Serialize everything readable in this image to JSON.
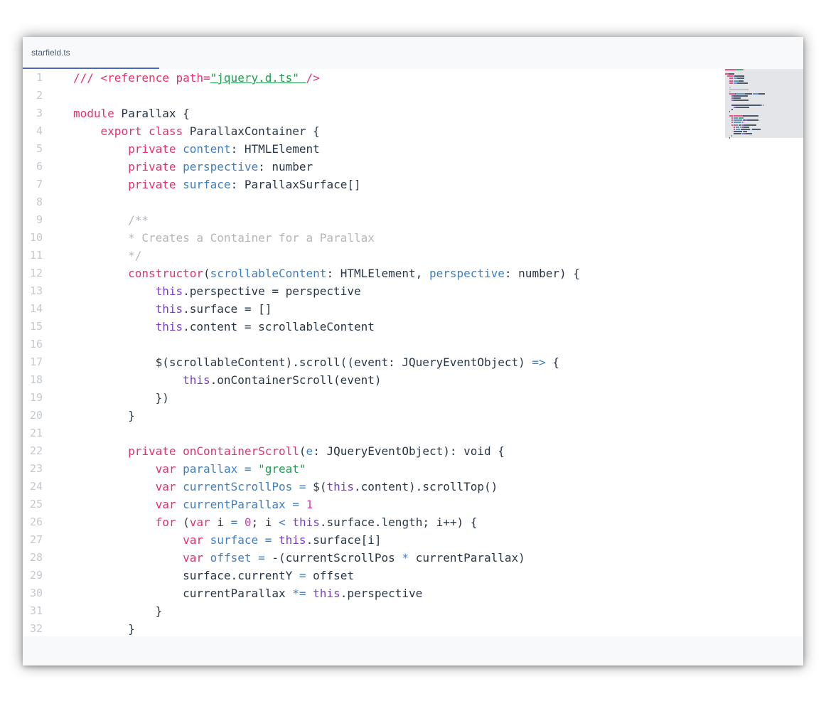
{
  "tab": {
    "label": "starfield.ts"
  },
  "colors": {
    "keyword": "#e2336b",
    "this": "#7a3ec4",
    "identifier": "#3f7fc0",
    "string": "#1e9e4e",
    "number": "#d63fb3",
    "comment": "#b3b7bc",
    "plain": "#283747",
    "tab_underline": "#4a6da7"
  },
  "line_numbers": [
    "1",
    "2",
    "3",
    "4",
    "5",
    "6",
    "7",
    "8",
    "9",
    "10",
    "11",
    "12",
    "13",
    "14",
    "15",
    "16",
    "17",
    "18",
    "19",
    "20",
    "21",
    "22",
    "23",
    "24",
    "25",
    "26",
    "27",
    "28",
    "29",
    "30",
    "31",
    "32"
  ],
  "lines": [
    [
      [
        "kw",
        "/// <reference path="
      ],
      [
        "strlink",
        "\"jquery.d.ts\" "
      ],
      [
        "kw",
        "/>"
      ]
    ],
    [],
    [
      [
        "kw",
        "module"
      ],
      [
        "plain",
        " Parallax {"
      ]
    ],
    [
      [
        "plain",
        "    "
      ],
      [
        "kw",
        "export"
      ],
      [
        "plain",
        " "
      ],
      [
        "kw",
        "class"
      ],
      [
        "plain",
        " ParallaxContainer {"
      ]
    ],
    [
      [
        "plain",
        "        "
      ],
      [
        "kw",
        "private"
      ],
      [
        "plain",
        " "
      ],
      [
        "id",
        "content"
      ],
      [
        "plain",
        ": HTMLElement"
      ]
    ],
    [
      [
        "plain",
        "        "
      ],
      [
        "kw",
        "private"
      ],
      [
        "plain",
        " "
      ],
      [
        "id",
        "perspective"
      ],
      [
        "plain",
        ": number"
      ]
    ],
    [
      [
        "plain",
        "        "
      ],
      [
        "kw",
        "private"
      ],
      [
        "plain",
        " "
      ],
      [
        "id",
        "surface"
      ],
      [
        "plain",
        ": ParallaxSurface[]"
      ]
    ],
    [],
    [
      [
        "cm",
        "        /**"
      ]
    ],
    [
      [
        "cm",
        "        * Creates a Container for a Parallax"
      ]
    ],
    [
      [
        "cm",
        "        */"
      ]
    ],
    [
      [
        "plain",
        "        "
      ],
      [
        "kw",
        "constructor"
      ],
      [
        "plain",
        "("
      ],
      [
        "id",
        "scrollableContent"
      ],
      [
        "plain",
        ": HTMLElement, "
      ],
      [
        "id",
        "perspective"
      ],
      [
        "plain",
        ": number) {"
      ]
    ],
    [
      [
        "plain",
        "            "
      ],
      [
        "this",
        "this"
      ],
      [
        "plain",
        ".perspective = perspective"
      ]
    ],
    [
      [
        "plain",
        "            "
      ],
      [
        "this",
        "this"
      ],
      [
        "plain",
        ".surface = []"
      ]
    ],
    [
      [
        "plain",
        "            "
      ],
      [
        "this",
        "this"
      ],
      [
        "plain",
        ".content = scrollableContent"
      ]
    ],
    [],
    [
      [
        "plain",
        "            $(scrollableContent).scroll((event: JQueryEventObject) "
      ],
      [
        "id",
        "=>"
      ],
      [
        "plain",
        " {"
      ]
    ],
    [
      [
        "plain",
        "                "
      ],
      [
        "this",
        "this"
      ],
      [
        "plain",
        ".onContainerScroll(event)"
      ]
    ],
    [
      [
        "plain",
        "            })"
      ]
    ],
    [
      [
        "plain",
        "        }"
      ]
    ],
    [],
    [
      [
        "plain",
        "        "
      ],
      [
        "kw",
        "private"
      ],
      [
        "plain",
        " "
      ],
      [
        "kw",
        "onContainerScroll"
      ],
      [
        "plain",
        "("
      ],
      [
        "id",
        "e"
      ],
      [
        "plain",
        ": JQueryEventObject): void {"
      ]
    ],
    [
      [
        "plain",
        "            "
      ],
      [
        "kw",
        "var"
      ],
      [
        "plain",
        " "
      ],
      [
        "id",
        "parallax"
      ],
      [
        "plain",
        " "
      ],
      [
        "id",
        "="
      ],
      [
        "plain",
        " "
      ],
      [
        "str",
        "\"great\""
      ]
    ],
    [
      [
        "plain",
        "            "
      ],
      [
        "kw",
        "var"
      ],
      [
        "plain",
        " "
      ],
      [
        "id",
        "currentScrollPos"
      ],
      [
        "plain",
        " "
      ],
      [
        "id",
        "="
      ],
      [
        "plain",
        " $("
      ],
      [
        "this",
        "this"
      ],
      [
        "plain",
        ".content).scrollTop()"
      ]
    ],
    [
      [
        "plain",
        "            "
      ],
      [
        "kw",
        "var"
      ],
      [
        "plain",
        " "
      ],
      [
        "id",
        "currentParallax"
      ],
      [
        "plain",
        " "
      ],
      [
        "id",
        "="
      ],
      [
        "plain",
        " "
      ],
      [
        "num",
        "1"
      ]
    ],
    [
      [
        "plain",
        "            "
      ],
      [
        "kw",
        "for"
      ],
      [
        "plain",
        " ("
      ],
      [
        "kw",
        "var"
      ],
      [
        "plain",
        " i "
      ],
      [
        "id",
        "="
      ],
      [
        "plain",
        " "
      ],
      [
        "num",
        "0"
      ],
      [
        "plain",
        "; i "
      ],
      [
        "id",
        "<"
      ],
      [
        "plain",
        " "
      ],
      [
        "this",
        "this"
      ],
      [
        "plain",
        ".surface.length; i++) {"
      ]
    ],
    [
      [
        "plain",
        "                "
      ],
      [
        "kw",
        "var"
      ],
      [
        "plain",
        " "
      ],
      [
        "id",
        "surface"
      ],
      [
        "plain",
        " "
      ],
      [
        "id",
        "="
      ],
      [
        "plain",
        " "
      ],
      [
        "this",
        "this"
      ],
      [
        "plain",
        ".surface[i]"
      ]
    ],
    [
      [
        "plain",
        "                "
      ],
      [
        "kw",
        "var"
      ],
      [
        "plain",
        " "
      ],
      [
        "id",
        "offset"
      ],
      [
        "plain",
        " "
      ],
      [
        "id",
        "="
      ],
      [
        "plain",
        " -(currentScrollPos "
      ],
      [
        "id",
        "*"
      ],
      [
        "plain",
        " currentParallax)"
      ]
    ],
    [
      [
        "plain",
        "                surface.currentY "
      ],
      [
        "id",
        "="
      ],
      [
        "plain",
        " offset"
      ]
    ],
    [
      [
        "plain",
        "                currentParallax "
      ],
      [
        "id",
        "*="
      ],
      [
        "plain",
        " "
      ],
      [
        "this",
        "this"
      ],
      [
        "plain",
        ".perspective"
      ]
    ],
    [
      [
        "plain",
        "            }"
      ]
    ],
    [
      [
        "plain",
        "        }"
      ]
    ]
  ]
}
